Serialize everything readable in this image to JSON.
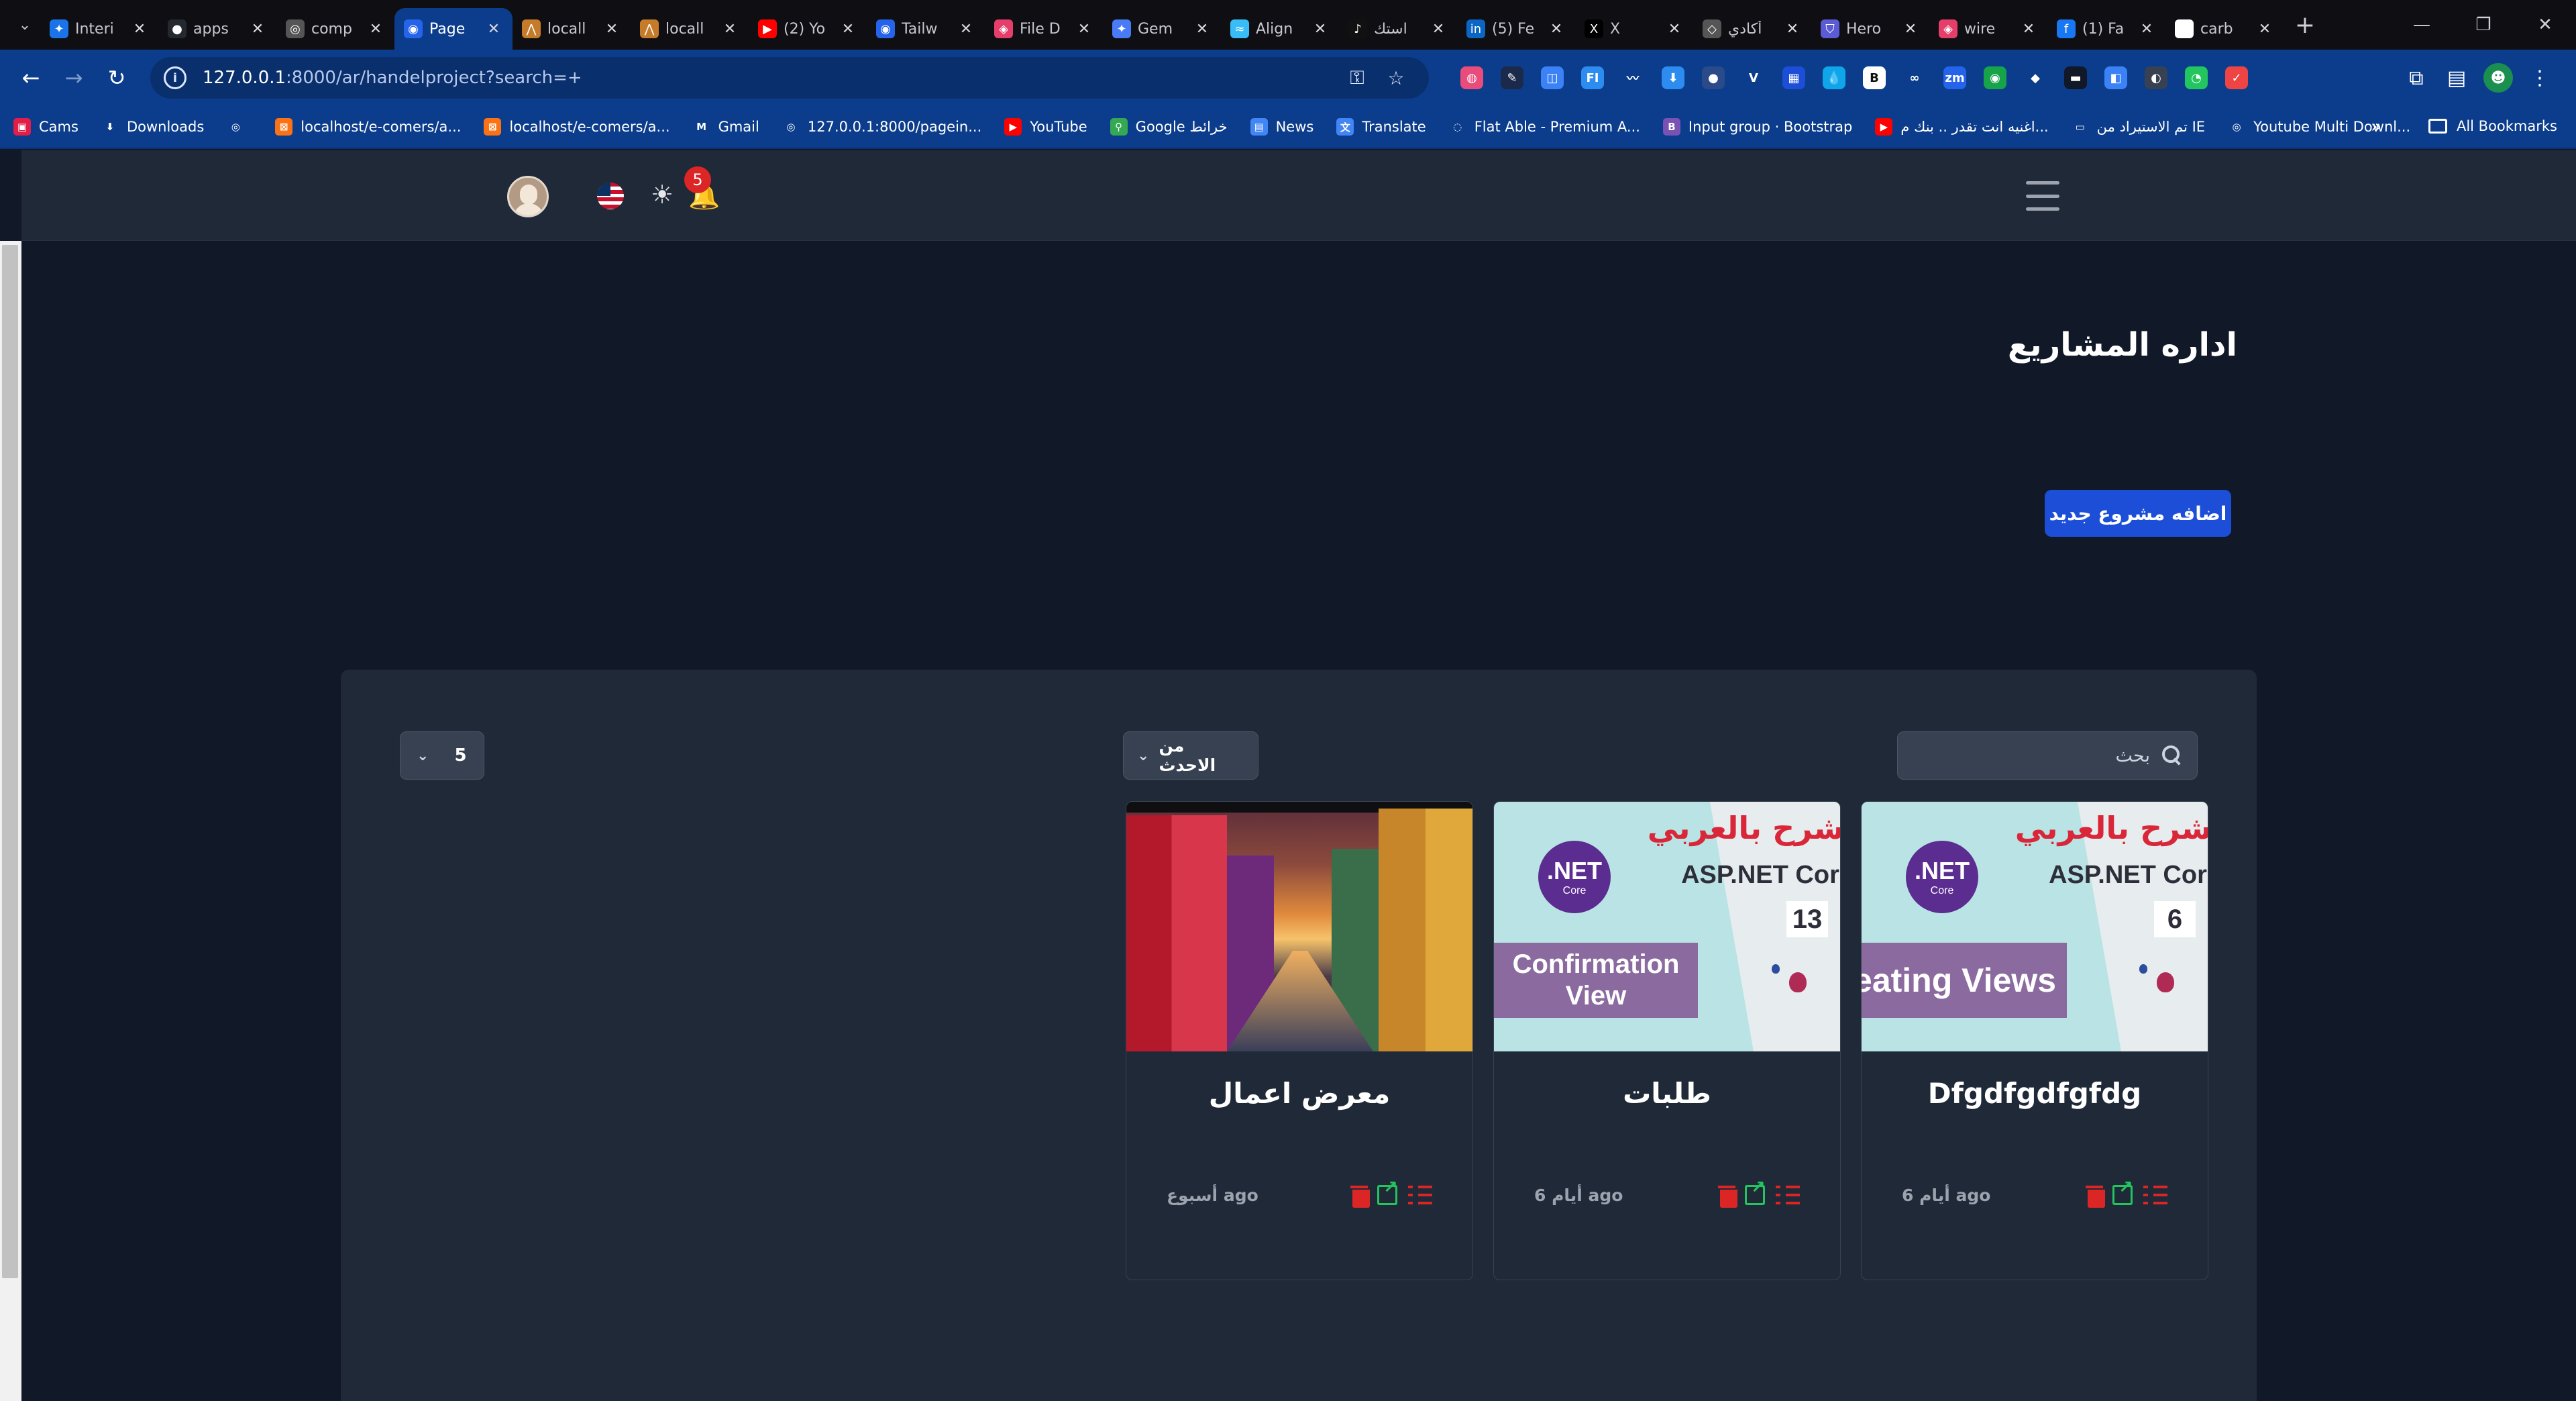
{
  "browser": {
    "tabs": [
      {
        "title": "Interi",
        "color": "#1a73e8",
        "glyph": "✦"
      },
      {
        "title": "apps",
        "color": "#24292f",
        "glyph": "●"
      },
      {
        "title": "comp",
        "color": "#555555",
        "glyph": "◎"
      },
      {
        "title": "Page",
        "color": "#2563eb",
        "glyph": "◉",
        "active": true
      },
      {
        "title": "locall",
        "color": "#c57b2a",
        "glyph": "⋀"
      },
      {
        "title": "locall",
        "color": "#c57b2a",
        "glyph": "⋀"
      },
      {
        "title": "(2) Yo",
        "color": "#ff0000",
        "glyph": "▶"
      },
      {
        "title": "Tailw",
        "color": "#2563eb",
        "glyph": "◉"
      },
      {
        "title": "File D",
        "color": "#e53e6b",
        "glyph": "◈"
      },
      {
        "title": "Gem",
        "color": "#4a7bf7",
        "glyph": "✦"
      },
      {
        "title": "Align",
        "color": "#38bdf8",
        "glyph": "≈"
      },
      {
        "title": "استك",
        "color": "#111111",
        "glyph": "♪"
      },
      {
        "title": "(5) Fe",
        "color": "#0a66c2",
        "glyph": "in"
      },
      {
        "title": "X",
        "color": "#000000",
        "glyph": "X"
      },
      {
        "title": "أكادي",
        "color": "#555555",
        "glyph": "◇"
      },
      {
        "title": "Hero",
        "color": "#5b5bd6",
        "glyph": "⛉"
      },
      {
        "title": "wire",
        "color": "#e53e6b",
        "glyph": "◈"
      },
      {
        "title": "(1) Fa",
        "color": "#1877f2",
        "glyph": "f"
      },
      {
        "title": "carb",
        "color": "#ffffff",
        "glyph": "G"
      }
    ],
    "close_glyph": "✕",
    "new_tab_glyph": "+",
    "window_controls": {
      "minimize": "—",
      "restore": "❐",
      "close": "✕"
    },
    "nav": {
      "back": "←",
      "forward": "→",
      "reload": "↻"
    },
    "address": {
      "host": "127.0.0.1",
      "rest": ":8000/ar/handelproject?search=+",
      "info_glyph": "i",
      "key_glyph": "⚿",
      "star_glyph": "☆"
    },
    "extensions": [
      {
        "color": "#e94b7a",
        "glyph": "◍"
      },
      {
        "color": "#1b2a4a",
        "glyph": "✎"
      },
      {
        "color": "#3b82f6",
        "glyph": "◫"
      },
      {
        "color": "#2d8cf0",
        "glyph": "FI"
      },
      {
        "color": "#0c3d8c",
        "glyph": "〰"
      },
      {
        "color": "#2d8cf0",
        "glyph": "⬇"
      },
      {
        "color": "#2a4a8a",
        "glyph": "●"
      },
      {
        "color": "#0c3d8c",
        "glyph": "V"
      },
      {
        "color": "#1d4ed8",
        "glyph": "▦"
      },
      {
        "color": "#0ea5e9",
        "glyph": "💧"
      },
      {
        "color": "#ffffff",
        "glyph": "B"
      },
      {
        "color": "#0c3d8c",
        "glyph": "∞"
      },
      {
        "color": "#2563eb",
        "glyph": "zm"
      },
      {
        "color": "#16a34a",
        "glyph": "◉"
      },
      {
        "color": "#0c3d8c",
        "glyph": "◆"
      },
      {
        "color": "#111827",
        "glyph": "▬"
      },
      {
        "color": "#3b82f6",
        "glyph": "◧"
      },
      {
        "color": "#374151",
        "glyph": "◐"
      },
      {
        "color": "#22c55e",
        "glyph": "◔"
      },
      {
        "color": "#ef4444",
        "glyph": "✓"
      }
    ],
    "toolbar_right": {
      "puzzle": "⧉",
      "reading": "▤",
      "profile": "☻",
      "menu": "⋮"
    },
    "bookmarks": [
      {
        "label": "Cams",
        "color": "#e11d48",
        "glyph": "▣"
      },
      {
        "label": "Downloads",
        "color": "#0c3d8c",
        "glyph": "⬇"
      },
      {
        "label": "",
        "color": "#0c3d8c",
        "glyph": "◎"
      },
      {
        "label": "localhost/e-comers/a...",
        "color": "#f97316",
        "glyph": "⊠"
      },
      {
        "label": "localhost/e-comers/a...",
        "color": "#f97316",
        "glyph": "⊠"
      },
      {
        "label": "Gmail",
        "color": "#0c3d8c",
        "glyph": "M"
      },
      {
        "label": "127.0.0.1:8000/pagein...",
        "color": "#0c3d8c",
        "glyph": "◎"
      },
      {
        "label": "YouTube",
        "color": "#ff0000",
        "glyph": "▶"
      },
      {
        "label": "Google خرائط",
        "color": "#34a853",
        "glyph": "⚲"
      },
      {
        "label": "News",
        "color": "#4285f4",
        "glyph": "▤"
      },
      {
        "label": "Translate",
        "color": "#4285f4",
        "glyph": "文"
      },
      {
        "label": "Flat Able - Premium A...",
        "color": "#0c3d8c",
        "glyph": "◌"
      },
      {
        "label": "Input group · Bootstrap",
        "color": "#7952b3",
        "glyph": "B"
      },
      {
        "label": "اغنيه انت تقدر .. بنك م...",
        "color": "#ff0000",
        "glyph": "▶"
      },
      {
        "label": "تم الاستيراد من IE",
        "color": "#0c3d8c",
        "glyph": "▭"
      },
      {
        "label": "Youtube Multi Downl...",
        "color": "#0c3d8c",
        "glyph": "◎"
      }
    ],
    "bookmarks_more": "»",
    "all_bookmarks": "All Bookmarks"
  },
  "header": {
    "sun_glyph": "☀",
    "bell_glyph": "🔔",
    "notification_count": "5"
  },
  "page": {
    "title": "اداره المشاريع",
    "add_button": "اضافه مشروع جديد",
    "per_page": "5",
    "sort": "من الاحدث",
    "chevron": "⌄",
    "search_placeholder": "بحث"
  },
  "projects": [
    {
      "title": "Dfgdfgdfgfdg",
      "date": "6 أيام ago",
      "thumb": "dotnet",
      "banner": "Creating Views",
      "number": "6"
    },
    {
      "title": "طلبات",
      "date": "6 أيام ago",
      "thumb": "dotnet",
      "banner": "Confirmation View",
      "number": "13"
    },
    {
      "title": "معرض اعمال",
      "date": "أسبوع ago",
      "thumb": "venice"
    }
  ],
  "thumb_text": {
    "arabic": "شرح بالعربي",
    "aspnet": "ASP.NET Core",
    "net": ".NET",
    "core": "Core"
  }
}
